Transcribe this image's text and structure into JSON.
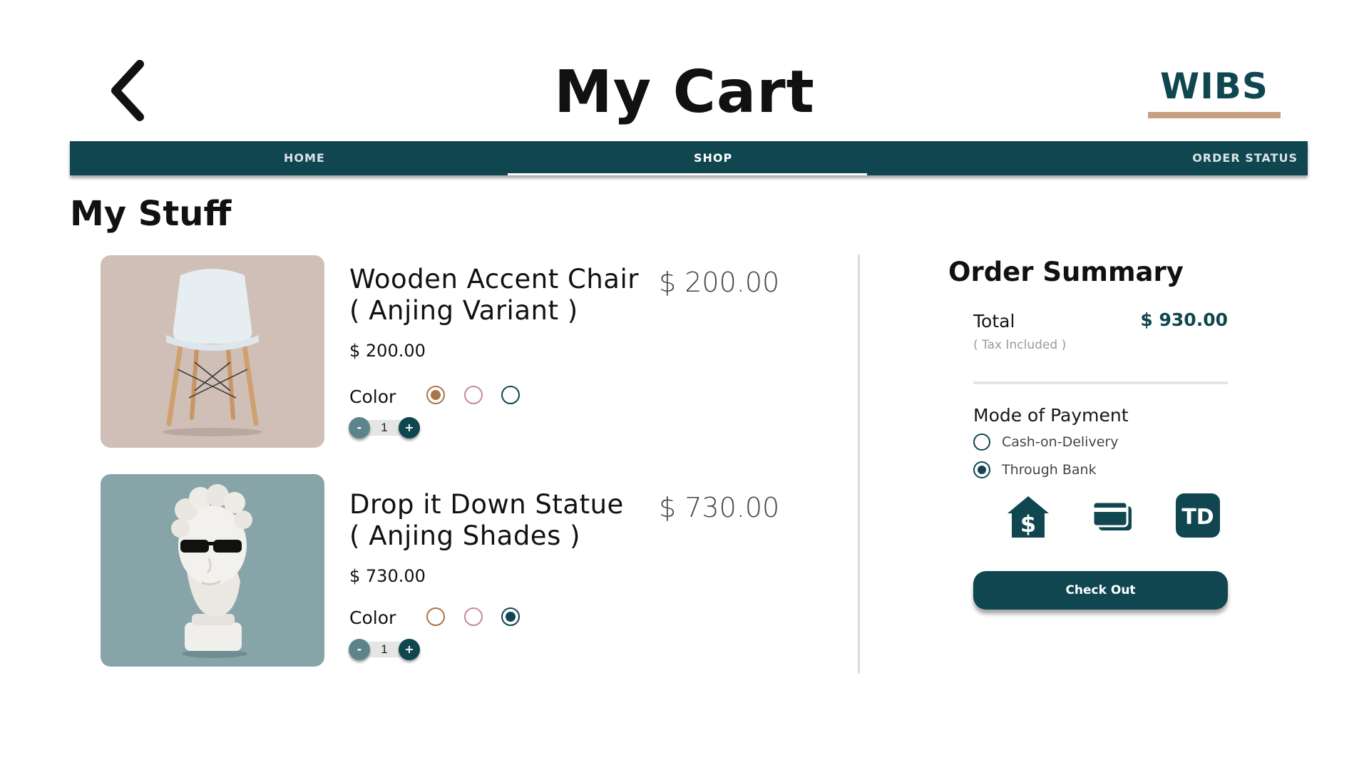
{
  "header": {
    "title": "My Cart",
    "brand": "WIBS"
  },
  "nav": {
    "items": [
      {
        "label": "HOME"
      },
      {
        "label": "SHOP"
      },
      {
        "label": "ORDER STATUS"
      }
    ],
    "active": "SHOP"
  },
  "section": {
    "title": "My Stuff"
  },
  "items": [
    {
      "name_line1": "Wooden Accent Chair",
      "name_line2": "( Anjing Variant )",
      "price_header": "$ 200.00",
      "price": "$ 200.00",
      "color_label": "Color",
      "quantity": "1",
      "minus_label": "-",
      "plus_label": "+",
      "swatches": [
        "#a8754b",
        "#c48a9d",
        "#0f4650"
      ],
      "selected_swatch": 0,
      "image_background": "#cfbfb6"
    },
    {
      "name_line1": "Drop it Down Statue",
      "name_line2": "( Anjing Shades )",
      "price_header": "$ 730.00",
      "price": "$ 730.00",
      "color_label": "Color",
      "quantity": "1",
      "minus_label": "-",
      "plus_label": "+",
      "swatches": [
        "#a8754b",
        "#c48a9d",
        "#0f4650"
      ],
      "selected_swatch": 2,
      "image_background": "#87a5a8"
    }
  ],
  "summary": {
    "title": "Order Summary",
    "total_label": "Total",
    "total_value": "$ 930.00",
    "tax_note": "( Tax Included )",
    "payment_label": "Mode of Payment",
    "payment_options": [
      {
        "label": "Cash-on-Delivery",
        "checked": false
      },
      {
        "label": "Through Bank",
        "checked": true
      }
    ],
    "bank_icons": [
      "bank-house-dollar-icon",
      "cards-icon",
      "td-bank-logo-icon"
    ],
    "td_logo_text": "TD",
    "checkout_label": "Check Out"
  },
  "colors": {
    "primary": "#0f4650",
    "accent": "#c9a084",
    "minus_button": "#5e848b",
    "nav_text": "#ffffff"
  }
}
